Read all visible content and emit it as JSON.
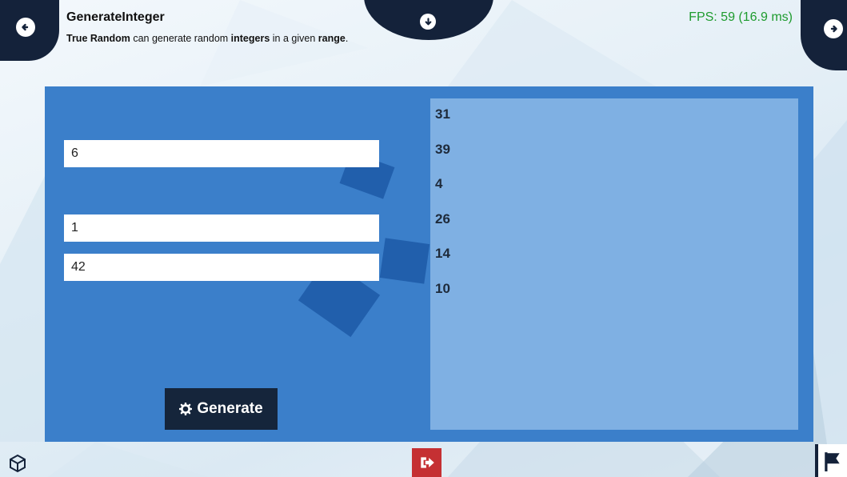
{
  "header": {
    "title": "GenerateInteger",
    "description_parts": [
      "True Random",
      " can generate random ",
      "integers",
      " in a given ",
      "range",
      "."
    ],
    "fps": "FPS: 59 (16.9 ms)"
  },
  "form": {
    "count_value": "6",
    "min_value": "1",
    "max_value": "42",
    "generate_label": "Generate"
  },
  "results": [
    "31",
    "39",
    "4",
    "26",
    "14",
    "10"
  ],
  "colors": {
    "panel": "#3b7fca",
    "results_bg": "#7fb0e3",
    "dark_nav": "#14223a",
    "fps_green": "#1e9b2e",
    "exit_red": "#c53033"
  },
  "icons": {
    "prev": "arrow-left-circle-icon",
    "next": "arrow-right-circle-icon",
    "toggle": "arrow-down-circle-icon",
    "generate": "gear-icon",
    "unity": "unity-logo-icon",
    "exit": "exit-icon",
    "flag": "flag-icon"
  }
}
